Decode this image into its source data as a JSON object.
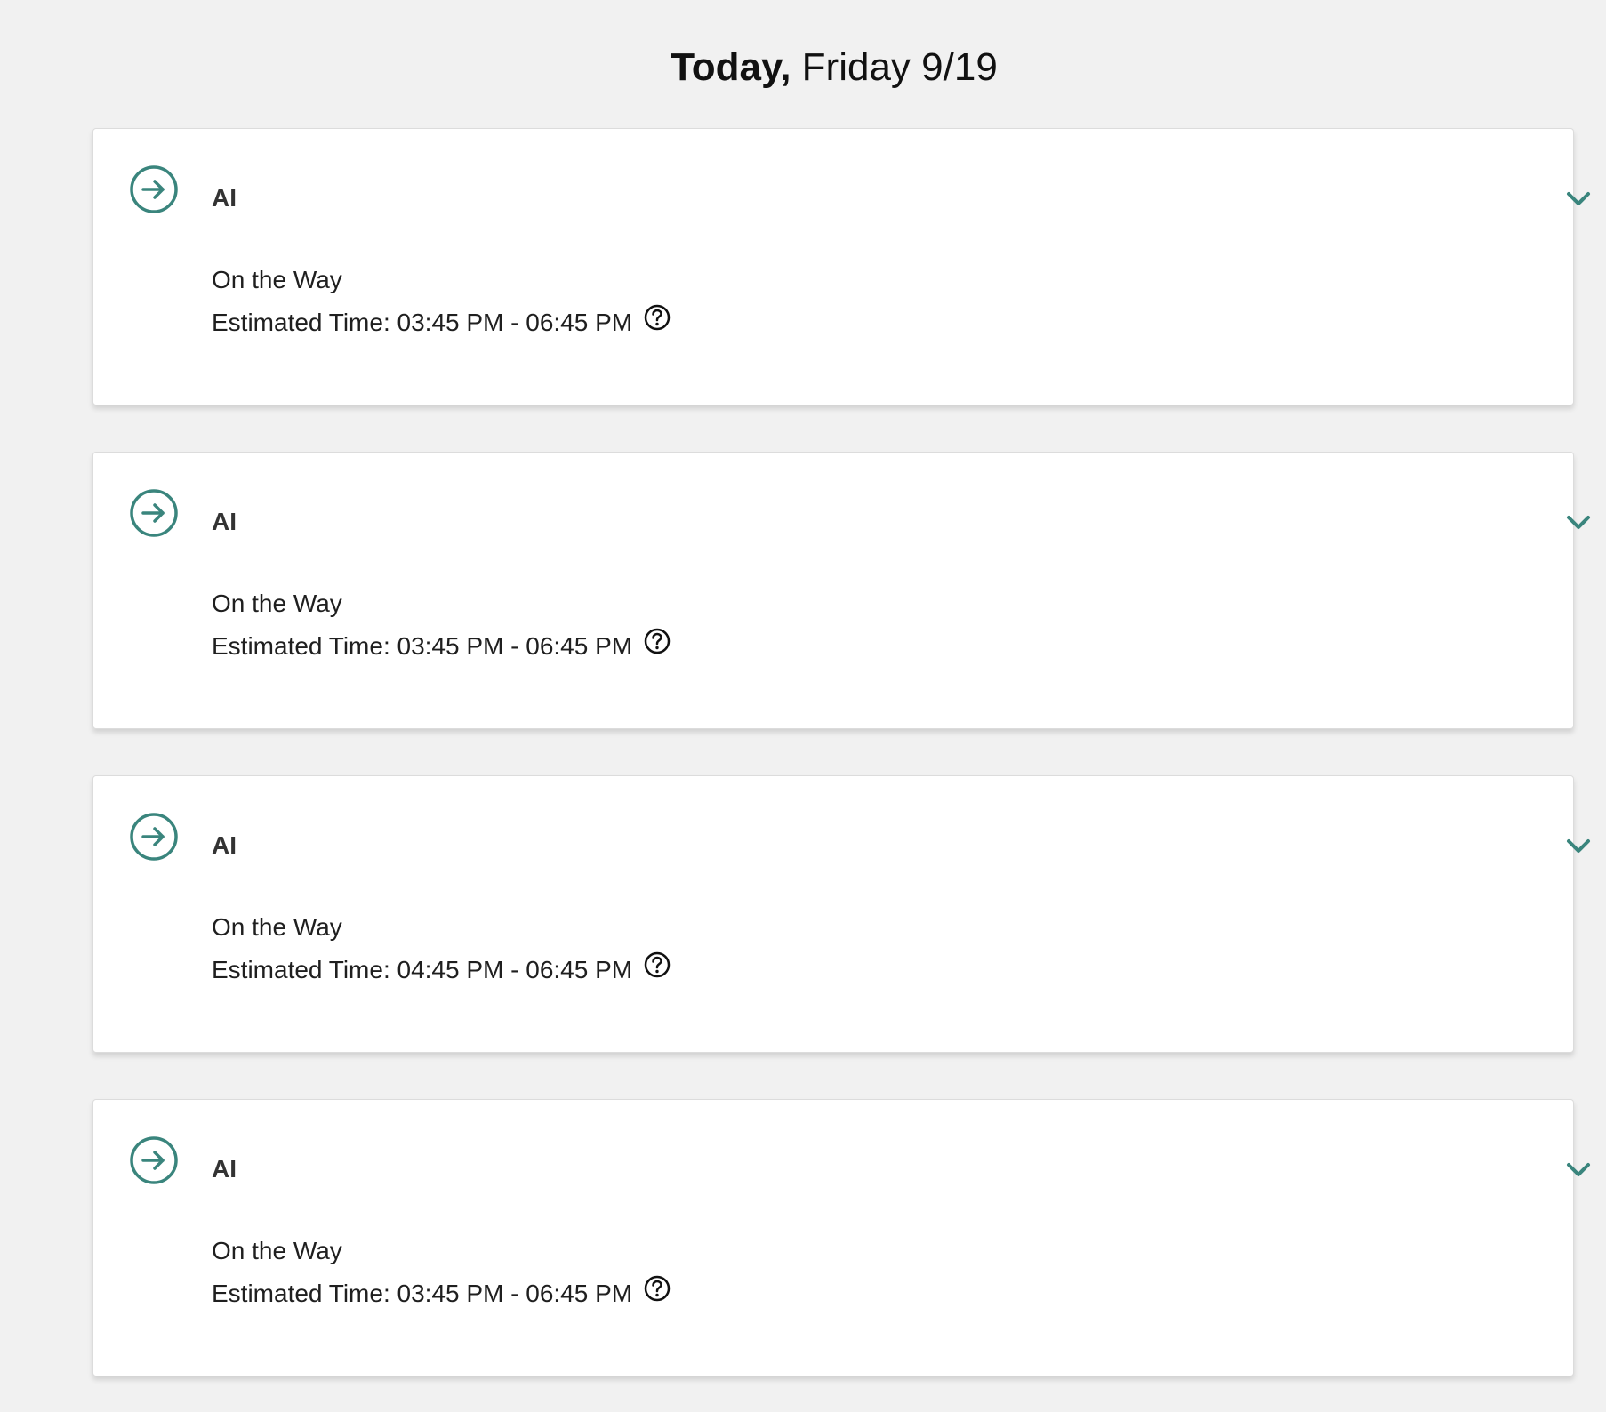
{
  "header": {
    "today_label": "Today,",
    "date_label": " Friday 9/19"
  },
  "colors": {
    "accent": "#3a857d",
    "background": "#f1f1f1",
    "card": "#ffffff"
  },
  "icons": {
    "status": "arrow-right-circle-icon",
    "expand": "chevron-down-icon",
    "help": "question-circle-icon"
  },
  "cards": [
    {
      "title": "AI",
      "status": "On the Way",
      "estimated_time": "Estimated Time: 03:45 PM - 06:45 PM"
    },
    {
      "title": "AI",
      "status": "On the Way",
      "estimated_time": "Estimated Time: 03:45 PM - 06:45 PM"
    },
    {
      "title": "AI",
      "status": "On the Way",
      "estimated_time": "Estimated Time: 04:45 PM - 06:45 PM"
    },
    {
      "title": "AI",
      "status": "On the Way",
      "estimated_time": "Estimated Time: 03:45 PM - 06:45 PM"
    }
  ]
}
